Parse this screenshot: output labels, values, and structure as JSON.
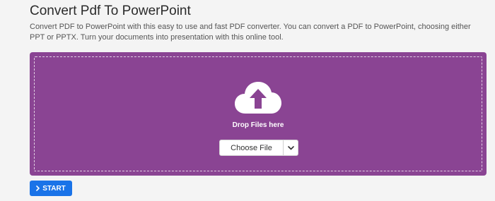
{
  "page": {
    "title": "Convert Pdf To PowerPoint",
    "description": "Convert PDF to PowerPoint with this easy to use and fast PDF converter. You can convert a PDF to PowerPoint, choosing either PPT or PPTX. Turn your documents into presentation with this online tool."
  },
  "drop_zone": {
    "label": "Drop Files here",
    "icon": "cloud-upload-icon",
    "background_color": "#8a4493"
  },
  "file_picker": {
    "choose_label": "Choose File",
    "dropdown_icon": "chevron-down-icon"
  },
  "start_button": {
    "label": "START",
    "icon": "chevron-right-icon",
    "color": "#1a73e8"
  }
}
